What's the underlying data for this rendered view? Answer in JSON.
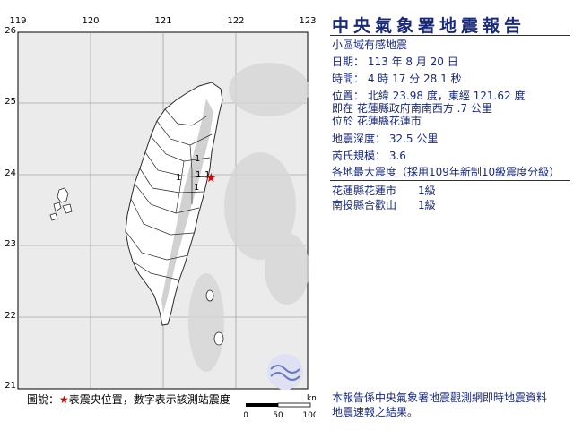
{
  "header": {
    "title": "中央氣象署地震報告",
    "subtitle": "小區域有感地震"
  },
  "report": {
    "date_label": "日期：",
    "date_value": "113 年 8 月 20 日",
    "time_label": "時間：",
    "time_value": "4 時 17 分 28.1 秒",
    "location_label": "位置：",
    "location_value": "北緯 23.98 度，東經 121.62 度",
    "location_line2": "即在 花蓮縣政府南南西方 .7 公里",
    "location_line3": "位於 花蓮縣花蓮市",
    "depth_label": "地震深度：",
    "depth_value": "32.5 公里",
    "magnitude_label": "芮氏規模：",
    "magnitude_value": "3.6",
    "intensity_heading": "各地最大震度（採用109年新制10級震度分級）"
  },
  "stations": [
    {
      "name": "花蓮縣花蓮市",
      "level": "1級"
    },
    {
      "name": "南投縣合歡山",
      "level": "1級"
    }
  ],
  "map": {
    "lon_ticks": [
      "119",
      "120",
      "121",
      "122",
      "123"
    ],
    "lat_ticks": [
      "26",
      "25",
      "24",
      "23",
      "22",
      "21"
    ],
    "intensity_markers": [
      "1",
      "1",
      "1",
      "1",
      "1"
    ],
    "scale_unit": "km",
    "scale_ticks": [
      "0",
      "50",
      "100"
    ],
    "colors": {
      "land": "#ffffff",
      "mountain": "#c9c9c9",
      "sea": "#ebebeb",
      "border": "#2a2a2a",
      "epicenter": "#e00000",
      "text": "#1a2a7a"
    }
  },
  "legend": {
    "prefix": "圖說：",
    "star": "★",
    "text": "表震央位置，數字表示該測站震度"
  },
  "footer": {
    "line1": "本報告係中央氣象署地震觀測網即時地震資料",
    "line2": "地震速報之結果。"
  }
}
